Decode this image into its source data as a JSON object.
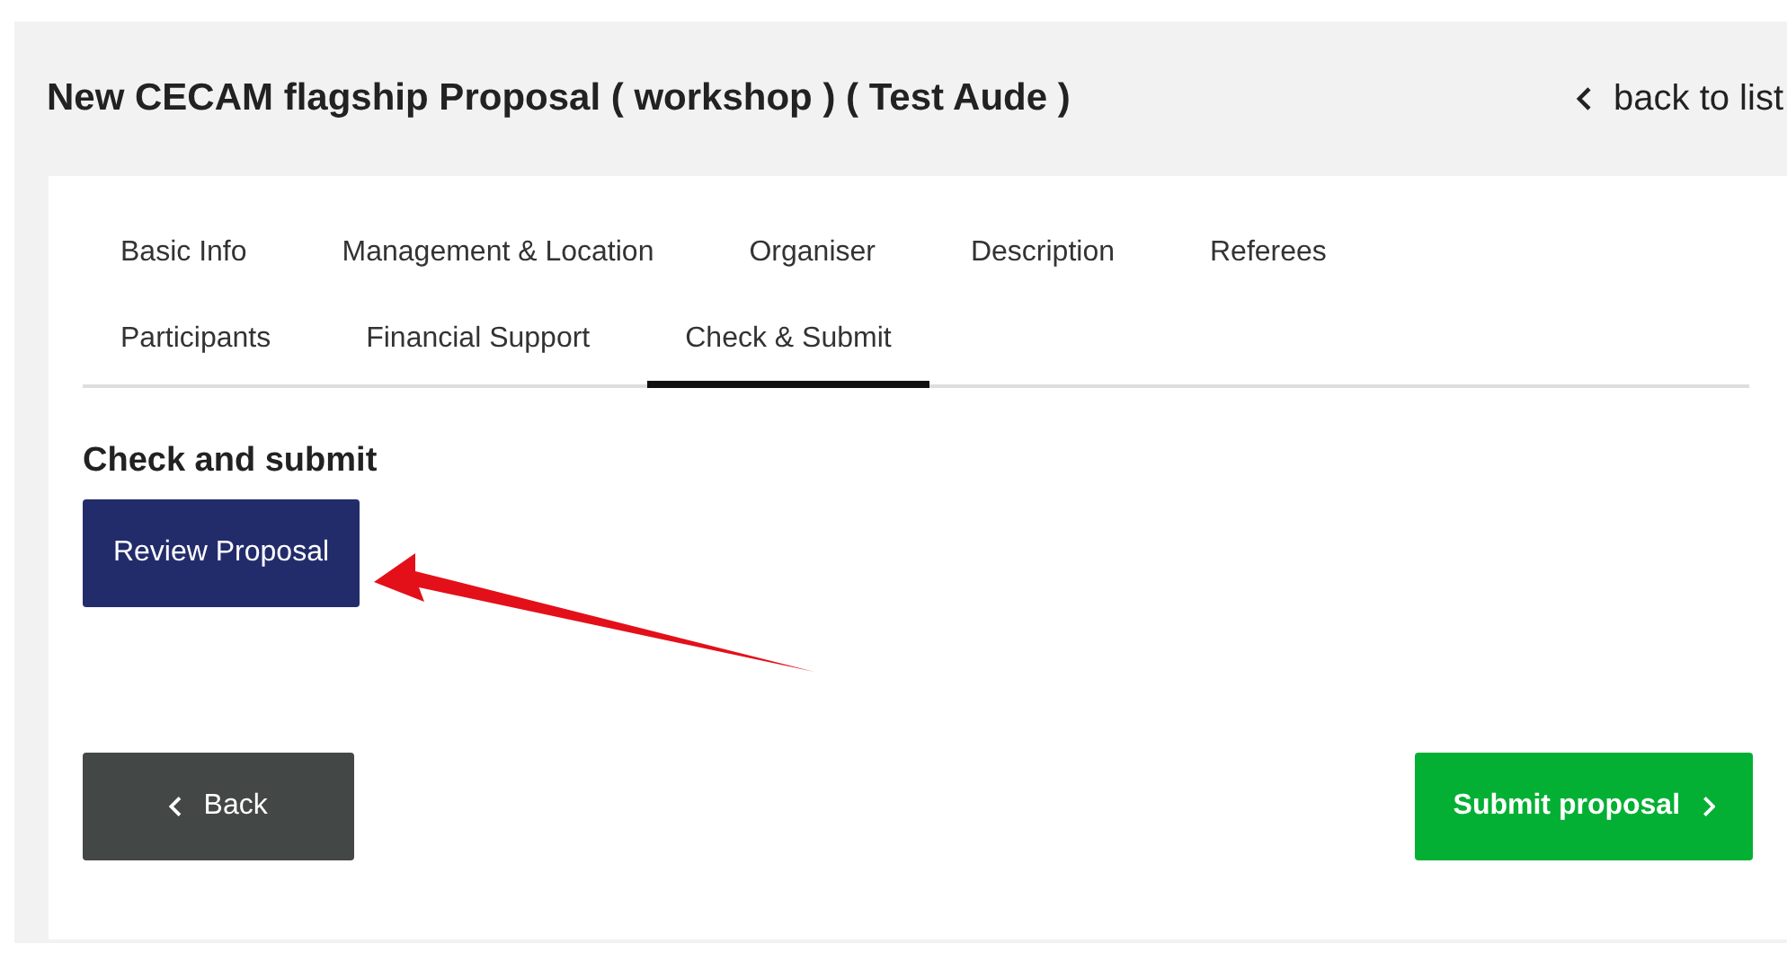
{
  "header": {
    "title": "New CECAM flagship Proposal ( workshop ) ( Test Aude )",
    "back_link": "back to list"
  },
  "tabs": [
    {
      "label": "Basic Info",
      "selected": false
    },
    {
      "label": "Management & Location",
      "selected": false
    },
    {
      "label": "Organiser",
      "selected": false
    },
    {
      "label": "Description",
      "selected": false
    },
    {
      "label": "Referees",
      "selected": false
    },
    {
      "label": "Participants",
      "selected": false
    },
    {
      "label": "Financial Support",
      "selected": false
    },
    {
      "label": "Check & Submit",
      "selected": true
    }
  ],
  "section": {
    "heading": "Check and submit",
    "review_button": "Review Proposal"
  },
  "footer": {
    "back_button": "Back",
    "submit_button": "Submit proposal"
  }
}
